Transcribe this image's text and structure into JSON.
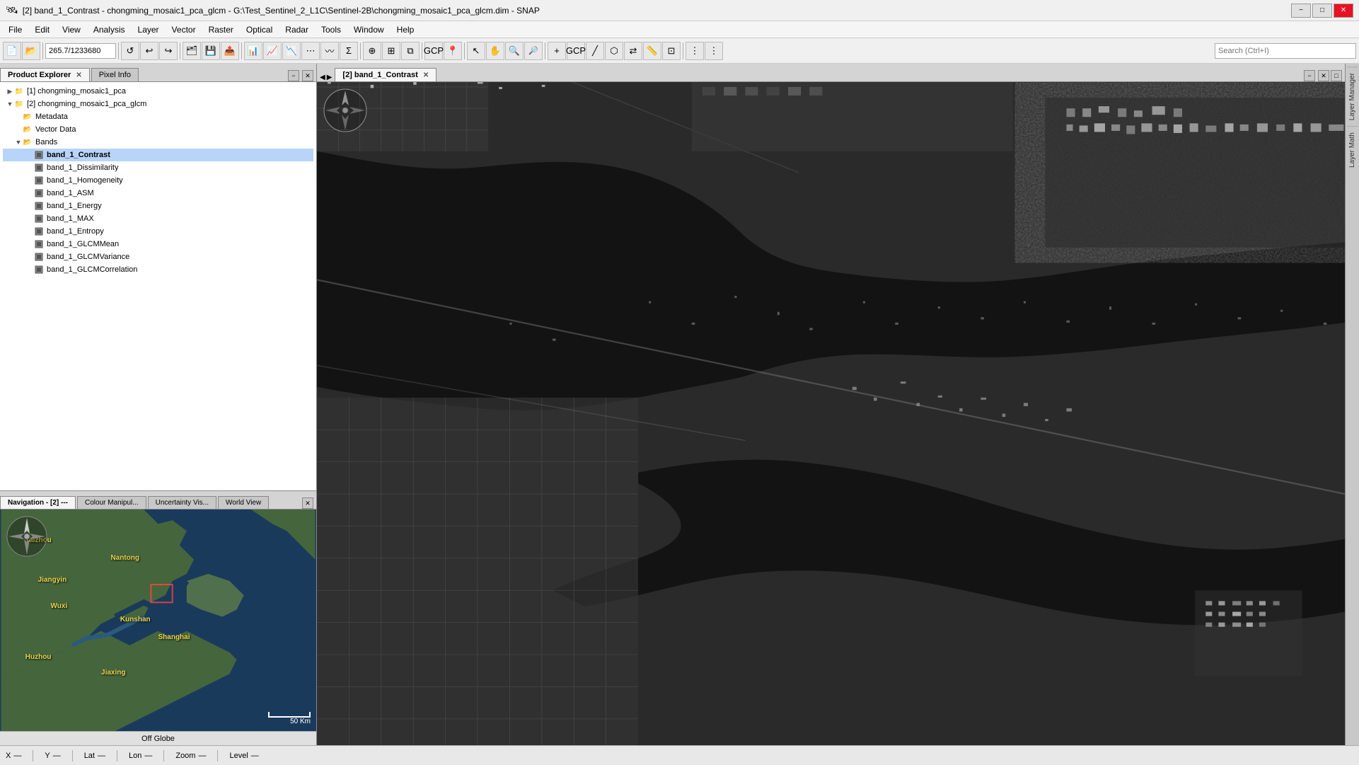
{
  "window": {
    "title": "[2] band_1_Contrast - chongming_mosaic1_pca_glcm - G:\\Test_Sentinel_2_L1C\\Sentinel-2B\\chongming_mosaic1_pca_glcm.dim - SNAP",
    "minimize": "−",
    "maximize": "□",
    "close": "✕"
  },
  "menu": {
    "items": [
      "File",
      "Edit",
      "View",
      "Analysis",
      "Layer",
      "Vector",
      "Raster",
      "Optical",
      "Radar",
      "Tools",
      "Window",
      "Help"
    ]
  },
  "toolbar": {
    "coord_value": "265.7/1233680",
    "search_placeholder": "Search (Ctrl+I)"
  },
  "left_panel": {
    "tabs": [
      {
        "label": "Product Explorer",
        "active": true
      },
      {
        "label": "Pixel Info",
        "active": false
      }
    ],
    "tree": [
      {
        "indent": 0,
        "expand": "▶",
        "icon": "📁",
        "label": "[1] chongming_mosaic1_pca",
        "selected": false
      },
      {
        "indent": 0,
        "expand": "▼",
        "icon": "📁",
        "label": "[2] chongming_mosaic1_pca_glcm",
        "selected": false
      },
      {
        "indent": 1,
        "expand": " ",
        "icon": "📂",
        "label": "Metadata",
        "selected": false
      },
      {
        "indent": 1,
        "expand": " ",
        "icon": "📂",
        "label": "Vector Data",
        "selected": false
      },
      {
        "indent": 1,
        "expand": "▼",
        "icon": "📂",
        "label": "Bands",
        "selected": false
      },
      {
        "indent": 2,
        "expand": " ",
        "icon": "🔲",
        "label": "band_1_Contrast",
        "selected": true
      },
      {
        "indent": 2,
        "expand": " ",
        "icon": "🔲",
        "label": "band_1_Dissimilarity",
        "selected": false
      },
      {
        "indent": 2,
        "expand": " ",
        "icon": "🔲",
        "label": "band_1_Homogeneity",
        "selected": false
      },
      {
        "indent": 2,
        "expand": " ",
        "icon": "🔲",
        "label": "band_1_ASM",
        "selected": false
      },
      {
        "indent": 2,
        "expand": " ",
        "icon": "🔲",
        "label": "band_1_Energy",
        "selected": false
      },
      {
        "indent": 2,
        "expand": " ",
        "icon": "🔲",
        "label": "band_1_MAX",
        "selected": false
      },
      {
        "indent": 2,
        "expand": " ",
        "icon": "🔲",
        "label": "band_1_Entropy",
        "selected": false
      },
      {
        "indent": 2,
        "expand": " ",
        "icon": "🔲",
        "label": "band_1_GLCMMean",
        "selected": false
      },
      {
        "indent": 2,
        "expand": " ",
        "icon": "🔲",
        "label": "band_1_GLCMVariance",
        "selected": false
      },
      {
        "indent": 2,
        "expand": " ",
        "icon": "🔲",
        "label": "band_1_GLCMCorrelation",
        "selected": false
      }
    ]
  },
  "navigation": {
    "tabs": [
      {
        "label": "Navigation - [2]",
        "suffix": "---",
        "active": true
      },
      {
        "label": "Colour Manipul...",
        "active": false
      },
      {
        "label": "Uncertainty Vis...",
        "active": false
      },
      {
        "label": "World View",
        "active": false
      }
    ],
    "map_labels": [
      {
        "text": "Taizhou",
        "top": "12%",
        "left": "8%"
      },
      {
        "text": "Nantong",
        "top": "20%",
        "left": "35%"
      },
      {
        "text": "Jiangyin",
        "top": "30%",
        "left": "12%"
      },
      {
        "text": "Wuxi",
        "top": "42%",
        "left": "16%"
      },
      {
        "text": "Kunshan",
        "top": "48%",
        "left": "38%"
      },
      {
        "text": "Shanghai",
        "top": "56%",
        "left": "50%"
      },
      {
        "text": "Huzhou",
        "top": "65%",
        "left": "8%"
      },
      {
        "text": "Jiaxing",
        "top": "72%",
        "left": "32%"
      }
    ],
    "footer": "Off Globe",
    "scale_text": "50 Km"
  },
  "image_view": {
    "tab_label": "[2] band_1_Contrast"
  },
  "statusbar": {
    "x_label": "X",
    "x_sep": "—",
    "y_label": "Y",
    "y_sep": "—",
    "lat_label": "Lat",
    "lat_sep": "—",
    "lon_label": "Lon",
    "lon_sep": "—",
    "zoom_label": "Zoom",
    "zoom_sep": "—",
    "level_label": "Level",
    "level_sep": "—"
  },
  "right_sidebar": {
    "tabs": [
      "Layer Manager",
      "Layer Math"
    ]
  },
  "icons": {
    "new": "📄",
    "open": "📂",
    "save": "💾",
    "undo": "↩",
    "redo": "↪",
    "zoom_in": "🔍",
    "zoom_out": "🔍",
    "pan": "✋",
    "select": "↖",
    "close": "✕",
    "minimize": "−",
    "maximize": "□"
  }
}
